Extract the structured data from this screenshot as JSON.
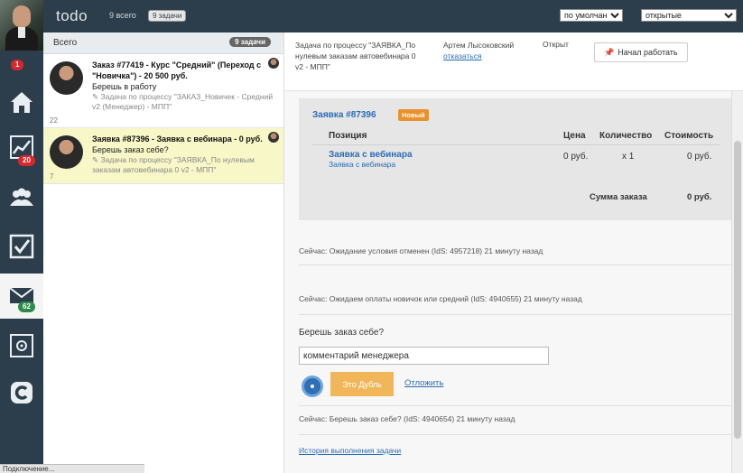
{
  "app": {
    "title": "todo"
  },
  "topbar": {
    "count_all": "9 всего",
    "count_tasks": "9 задачи",
    "sort_select": "по умолчанию",
    "status_select": "открытые"
  },
  "rail": {
    "badges": {
      "first": "1",
      "chart": "20",
      "mail": "62"
    },
    "icons": [
      "home-icon",
      "chart-icon",
      "users-icon",
      "checkbox-icon",
      "mail-icon",
      "safe-icon",
      "c-logo-icon"
    ]
  },
  "list": {
    "title": "Всего",
    "badge": "9 задачи",
    "tasks": [
      {
        "title": "Заказ #77419 - Курс \"Средний\" (Переход с \"Новичка\") - 20 500 руб.",
        "subtitle": "Берешь в работу",
        "meta": "Задача  по процессу \"ЗАКАЗ_Новичек - Средний v2 (Менеджер) - МПП\"",
        "number": "22"
      },
      {
        "title": "Заявка #87396 - Заявка с вебинара - 0 руб.",
        "subtitle": "Берешь заказ себе?",
        "meta": "Задача  по процессу \"ЗАЯВКА_По нулевым заказам автовебинара 0 v2 - МПП\"",
        "number": "7"
      }
    ]
  },
  "header": {
    "process": "Задача по процессу \"ЗАЯВКА_По нулевым заказам автовебинара 0 v2 - МПП\"",
    "person": "Артем Лысоковский",
    "refuse": "отказаться",
    "status": "Открыт",
    "start_button": "Начал работать"
  },
  "order": {
    "title": "Заявка #87396",
    "tag": "Новый",
    "columns": [
      "Позиция",
      "Цена",
      "Количество",
      "Стоимость"
    ],
    "item": {
      "name": "Заявка с вебинара",
      "sub": "Заявка с вебинара",
      "price": "0 руб.",
      "qty": "x 1",
      "cost": "0 руб."
    },
    "total_label": "Сумма заказа",
    "total_value": "0 руб."
  },
  "log": {
    "entry1": "Сейчас: Ожидание условия отменен (IdS: 4957218) 21 минуту назад",
    "entry2": "Сейчас: Ожидаем оплаты новичок или средний (IdS: 4940655) 21 минуту назад",
    "entry3": "Сейчас: Берешь заказ себе? (IdS: 4940654) 21 минуту назад"
  },
  "action": {
    "question": "Берешь заказ себе?",
    "comment_value": "комментарий менеджера",
    "duplicate_button": "Это Дубль",
    "postpone": "Отложить"
  },
  "history_link": "История выполнения задачи",
  "statusbar": "Подключение...",
  "colors": {
    "dark": "#2c3e4c",
    "link": "#2a6db5",
    "orange": "#f1b65a",
    "tag": "#e8912d",
    "selected": "#f8f7c8"
  }
}
